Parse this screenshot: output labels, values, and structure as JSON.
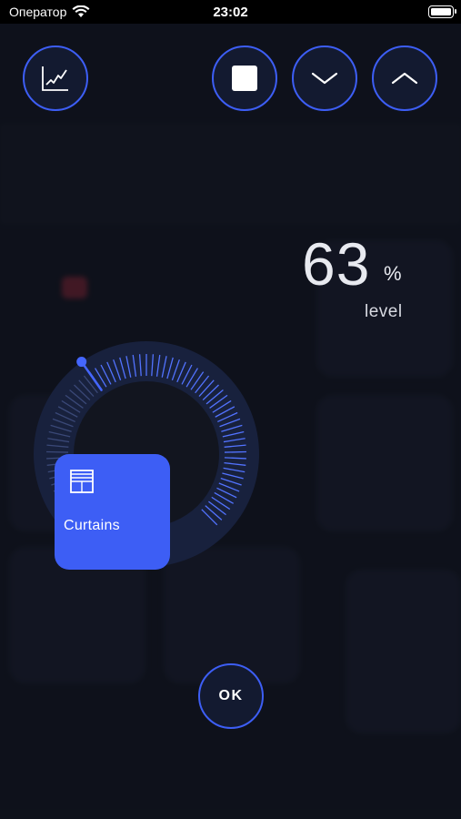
{
  "status_bar": {
    "carrier": "Оператор",
    "time": "23:02"
  },
  "toolbar": {
    "chart_icon": "chart-icon",
    "stop_icon": "stop-icon",
    "down_icon": "chevron-down-icon",
    "up_icon": "chevron-up-icon"
  },
  "level": {
    "value": "63",
    "unit": "%",
    "label": "level",
    "fraction": 0.63
  },
  "device": {
    "name": "Curtains",
    "icon": "curtains-icon"
  },
  "confirm": {
    "label": "OK"
  },
  "colors": {
    "accent": "#3d5ef5",
    "background": "#12151f",
    "tile": "#3d5ef5"
  }
}
